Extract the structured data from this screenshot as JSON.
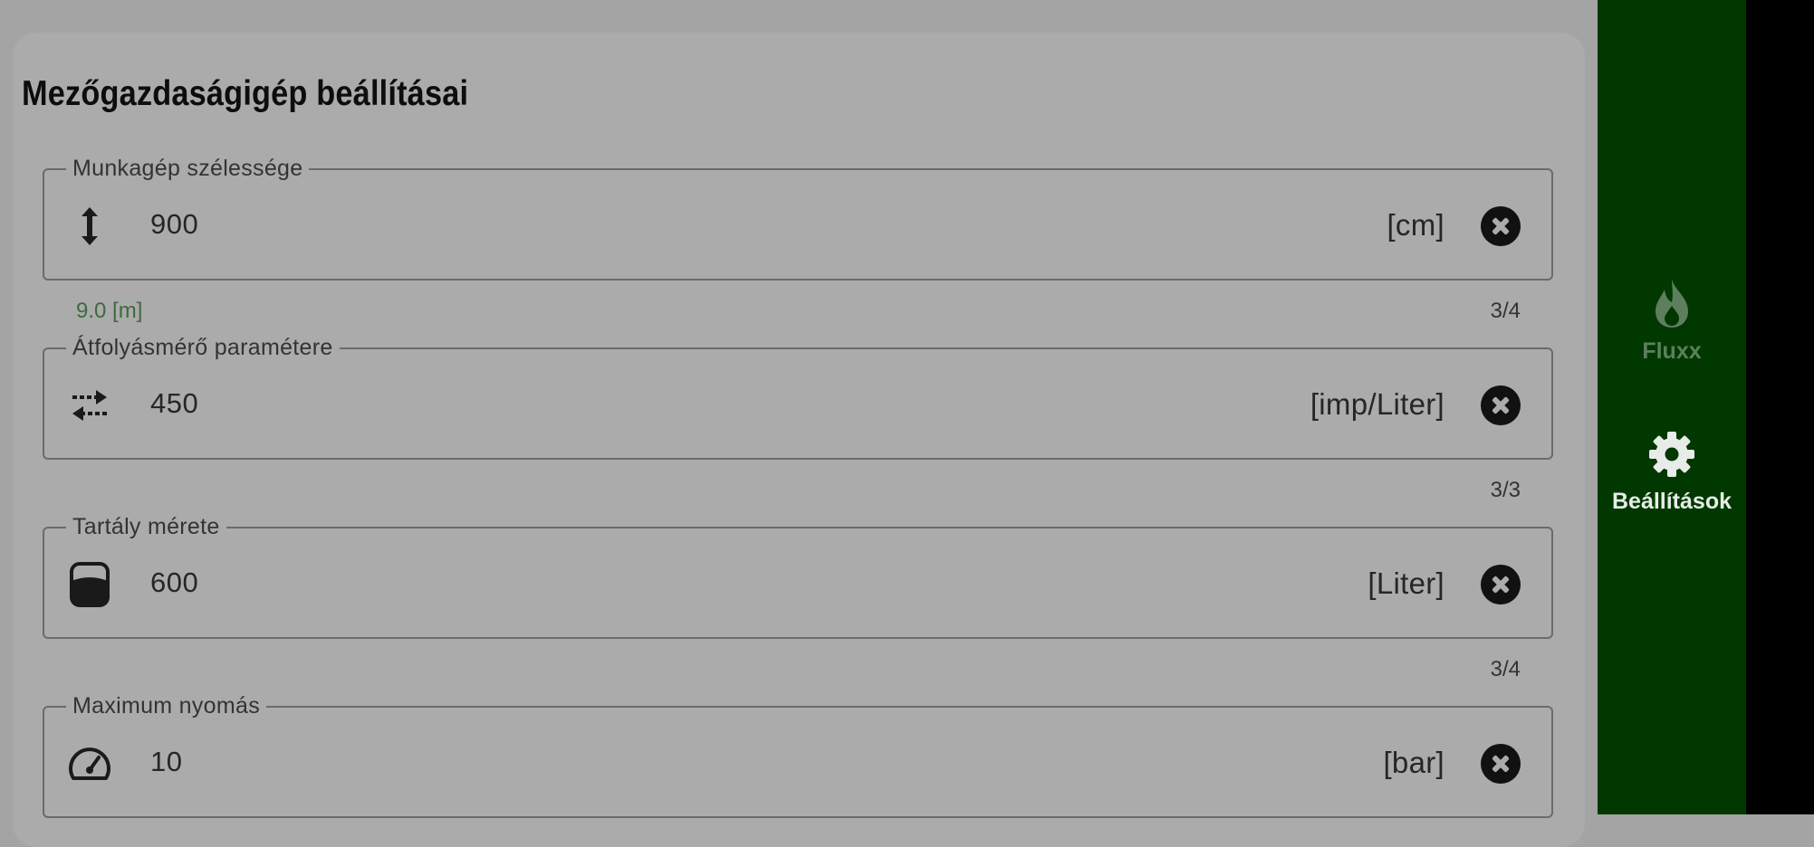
{
  "page": {
    "title": "Mezőgazdaságigép beállításai"
  },
  "fields": [
    {
      "label": "Munkagép szélessége",
      "icon": "vertical-resize-icon",
      "value": "900",
      "unit": "[cm]",
      "helper": "9.0 [m]",
      "counter": "3/4"
    },
    {
      "label": "Átfolyásmérő paramétere",
      "icon": "swap-arrows-icon",
      "value": "450",
      "unit": "[imp/Liter]",
      "helper": "",
      "counter": "3/3"
    },
    {
      "label": "Tartály mérete",
      "icon": "tank-icon",
      "value": "600",
      "unit": "[Liter]",
      "helper": "",
      "counter": "3/4"
    },
    {
      "label": "Maximum nyomás",
      "icon": "gauge-icon",
      "value": "10",
      "unit": "[bar]",
      "helper": "",
      "counter": ""
    }
  ],
  "nav": {
    "items": [
      {
        "label": "Fluxx",
        "icon": "flame-icon",
        "active": false
      },
      {
        "label": "Beállítások",
        "icon": "gear-icon",
        "active": true
      }
    ]
  },
  "colors": {
    "rail": "#003800",
    "helper_text": "#3d6b3d",
    "background": "#a4a4a4",
    "card": "#ababab"
  }
}
